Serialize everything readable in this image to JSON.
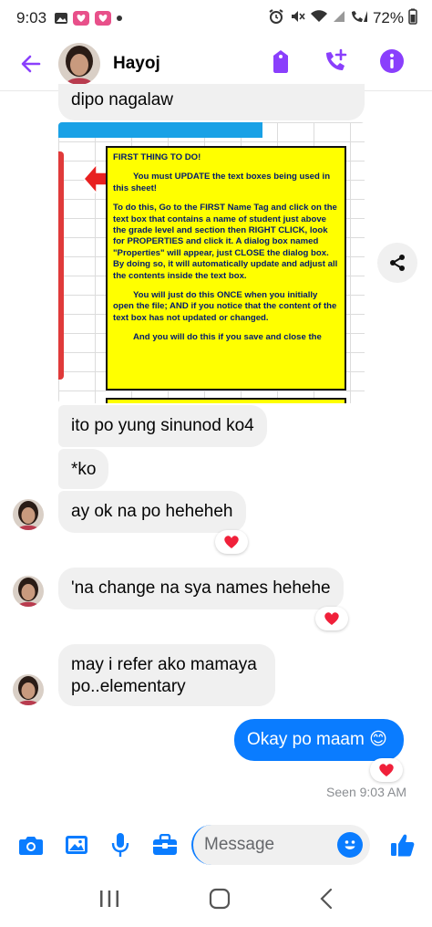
{
  "status_bar": {
    "time": "9:03",
    "battery": "72%"
  },
  "header": {
    "contact_name": "Hayoj",
    "icons": [
      "back-arrow-icon",
      "tag-icon",
      "add-call-icon",
      "info-icon"
    ]
  },
  "attachment": {
    "title": "FIRST THING TO DO!",
    "paragraphs": [
      "You must UPDATE the text boxes being used in this sheet!",
      "To do this, Go to the FIRST Name Tag and click on the text box that contains a name of student just above the grade level and section then RIGHT CLICK, look for PROPERTIES and click it. A dialog box named \"Properties\" will appear, just CLOSE the dialog box. By doing so, it will automatically update and adjust all the contents inside the text box.",
      "You will just do this ONCE when you initially open the file; AND if you notice that the content of the text box has not updated or changed.",
      "And you will do this if you save and close the"
    ]
  },
  "messages": {
    "m1": "dipo nagalaw",
    "m2": "ito po yung sinunod ko4",
    "m3": "*ko",
    "m4": "ay ok na po heheheh",
    "m5": "'na change na sya names hehehe",
    "m6_line1": "may i refer ako mamaya",
    "m6_line2": "po..elementary",
    "m7_text": "Okay po maam",
    "m7_emoji": "😊",
    "reaction_emoji": "❤️"
  },
  "seen_text": "Seen 9:03 AM",
  "composer": {
    "placeholder": "Message"
  },
  "colors": {
    "accent": "#8a3ffc",
    "bubble_out": "#0a7cff",
    "bubble_in": "#f0f0f0"
  }
}
